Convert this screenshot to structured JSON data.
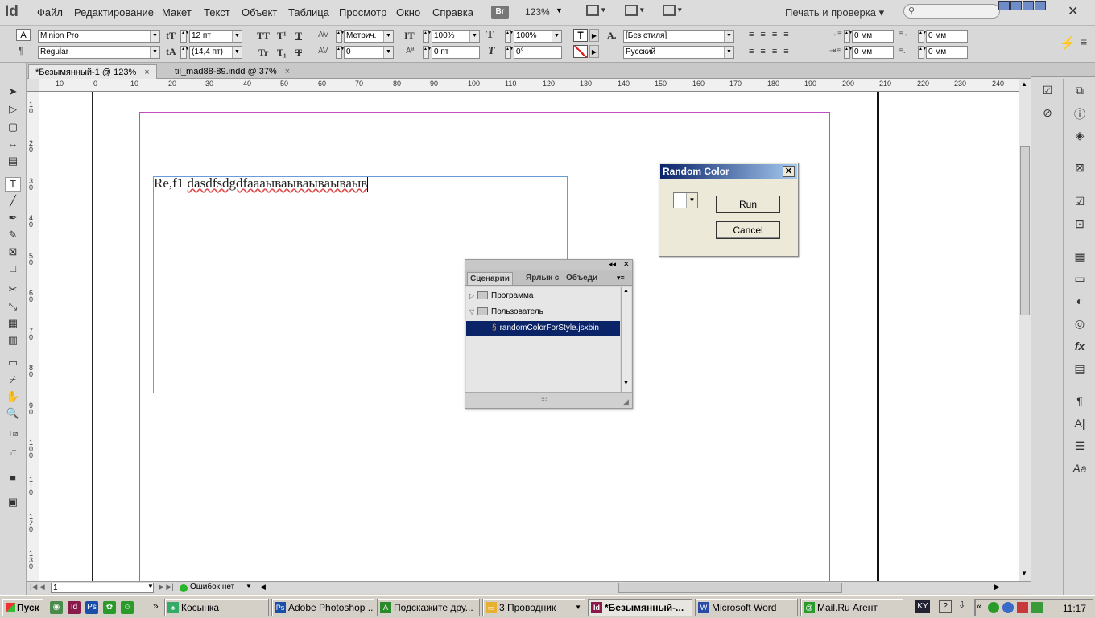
{
  "app": {
    "logo": "Id",
    "menu": [
      "Файл",
      "Редактирование",
      "Макет",
      "Текст",
      "Объект",
      "Таблица",
      "Просмотр",
      "Окно",
      "Справка"
    ],
    "bridge_label": "Br",
    "zoom": "123%",
    "workspace": "Печать и проверка"
  },
  "control": {
    "font_family": "Minion Pro",
    "font_style": "Regular",
    "font_size": "12 пт",
    "leading": "(14,4 пт)",
    "kerning": "Метрич.",
    "tracking": "0",
    "v_scale": "100%",
    "h_scale": "100%",
    "baseline_shift": "0 пт",
    "skew": "0°",
    "char_style": "[Без стиля]",
    "language": "Русский",
    "left_indent": "0 мм",
    "first_indent": "0 мм",
    "right_indent": "0 мм",
    "last_indent": "0 мм",
    "icons": {
      "caps": "TT",
      "superscript": "T¹",
      "underline": "T",
      "small_caps": "Tr",
      "subscript": "T₁",
      "strike": "T"
    }
  },
  "tabs": [
    {
      "label": "*Безымянный-1 @ 123%",
      "close": "×"
    },
    {
      "label": "til_mad88-89.indd @ 37%",
      "close": "×"
    }
  ],
  "hruler_labels": [
    "10",
    "0",
    "10",
    "20",
    "30",
    "40",
    "50",
    "60",
    "70",
    "80",
    "90",
    "100",
    "110",
    "120",
    "130",
    "140",
    "150",
    "160",
    "170",
    "180",
    "190",
    "200",
    "210",
    "220",
    "230",
    "240"
  ],
  "vruler_labels": [
    "10",
    "20",
    "30",
    "40",
    "50",
    "60",
    "70",
    "80",
    "90",
    "100",
    "110",
    "120",
    "130"
  ],
  "document": {
    "text_plain": "Re,f1 ",
    "text_squiggle": "dasdfsdgdfaaaываываываываыв"
  },
  "scripts_panel": {
    "tabs": [
      "Сценарии",
      "Ярлык с",
      "Объеди"
    ],
    "rows": [
      {
        "label": "Программа",
        "expanded": false
      },
      {
        "label": "Пользователь",
        "expanded": true
      },
      {
        "label": "randomColorForStyle.jsxbin",
        "selected": true
      }
    ]
  },
  "dialog": {
    "title": "Random Color",
    "close": "✕",
    "run": "Run",
    "cancel": "Cancel"
  },
  "status": {
    "page": "1",
    "errors": "Ошибок нет"
  },
  "taskbar": {
    "start": "Пуск",
    "chevron": "»",
    "tasks": [
      {
        "label": "Косынка",
        "color": "#3a6"
      },
      {
        "label": "Adobe Photoshop ...",
        "color": "#1a4ea8"
      },
      {
        "label": "Подскажите дру...",
        "color": "#2a8a2a"
      },
      {
        "label": "3 Проводник",
        "color": "#e8b030"
      },
      {
        "label": "*Безымянный-...",
        "color": "#8a1a4a",
        "active": true
      },
      {
        "label": "Microsoft Word",
        "color": "#2a4aa8"
      },
      {
        "label": "Mail.Ru Агент",
        "color": "#2a9a2a"
      }
    ],
    "lang": "KY",
    "clock": "11:17"
  }
}
